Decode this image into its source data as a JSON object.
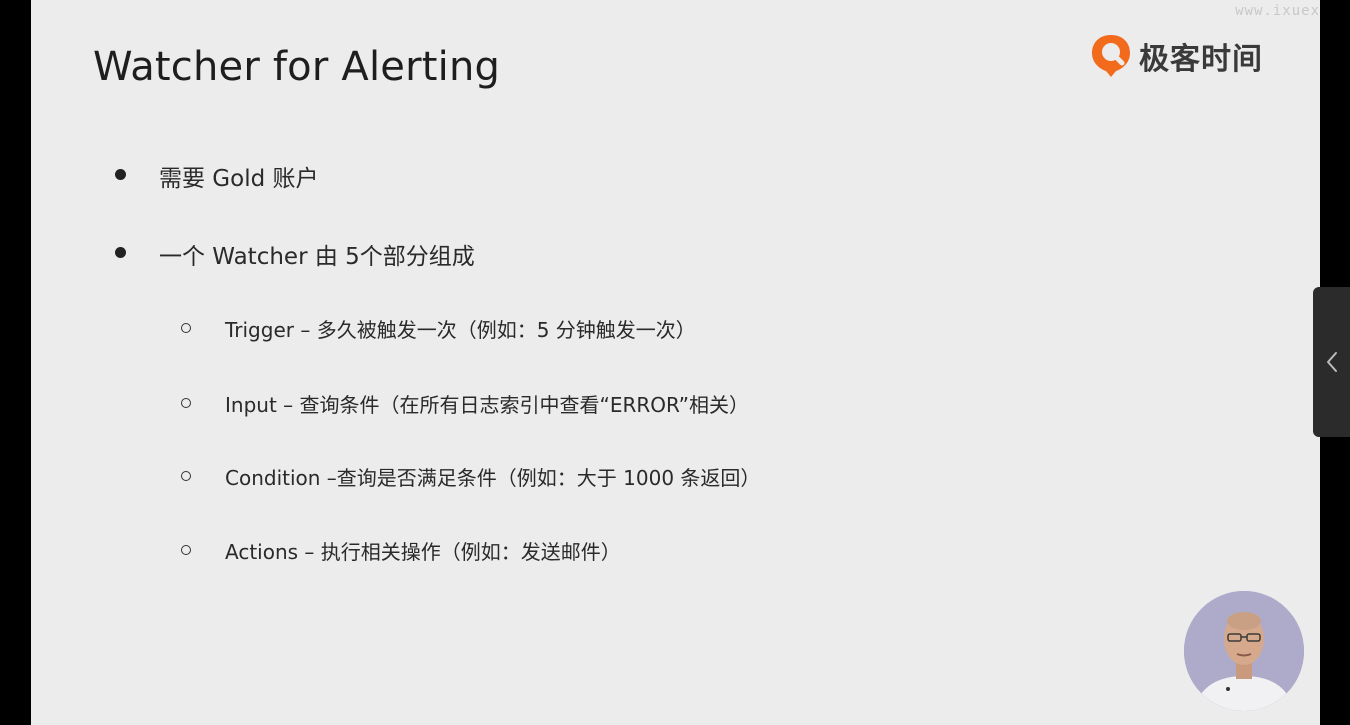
{
  "slide": {
    "title": "Watcher for Alerting",
    "watermark": "www.ixuex",
    "logo_text": "极客时间",
    "bullets": [
      {
        "text": "需要 Gold 账户"
      },
      {
        "text": "一个 Watcher 由 5个部分组成"
      }
    ],
    "sub_bullets": [
      {
        "text": "Trigger – 多久被触发一次（例如：5 分钟触发一次）"
      },
      {
        "text": "Input – 查询条件（在所有日志索引中查看“ERROR”相关）"
      },
      {
        "text": "Condition –查询是否满足条件（例如：大于 1000 条返回）"
      },
      {
        "text": "Actions – 执行相关操作（例如：发送邮件）"
      }
    ]
  },
  "colors": {
    "logo_orange": "#f26a1b",
    "background": "#ececec",
    "text": "#2a2a2a"
  },
  "icons": {
    "sidebar_toggle": "chevron-left-icon",
    "presenter": "presenter-avatar"
  }
}
